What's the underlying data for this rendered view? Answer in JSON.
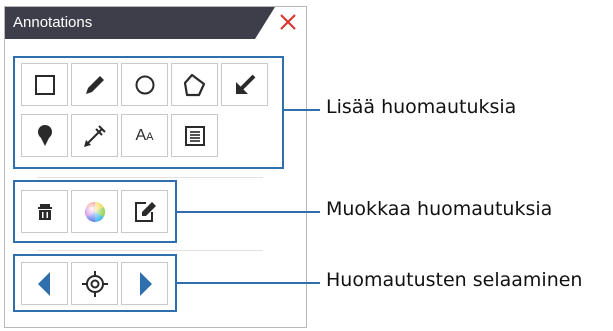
{
  "panel": {
    "title": "Annotations",
    "close_icon": "close-icon",
    "accent_color": "#2f6fae",
    "close_color": "#d9342b",
    "titlebar_color": "#3d3e4a"
  },
  "groups": [
    {
      "id": "add",
      "tools": [
        "rectangle-icon",
        "pencil-icon",
        "circle-icon",
        "polygon-icon",
        "arrow-icon",
        "pin-icon",
        "measure-icon",
        "text-icon",
        "note-icon"
      ],
      "text_tool_label": {
        "big": "A",
        "small": "A"
      }
    },
    {
      "id": "edit",
      "tools": [
        "trash-icon",
        "color-wheel-icon",
        "edit-icon"
      ]
    },
    {
      "id": "navigate",
      "tools": [
        "previous-icon",
        "center-target-icon",
        "next-icon"
      ]
    }
  ],
  "callouts": {
    "add": "Lisää huomautuksia",
    "edit": "Muokkaa huomautuksia",
    "navigate": "Huomautusten selaaminen"
  }
}
